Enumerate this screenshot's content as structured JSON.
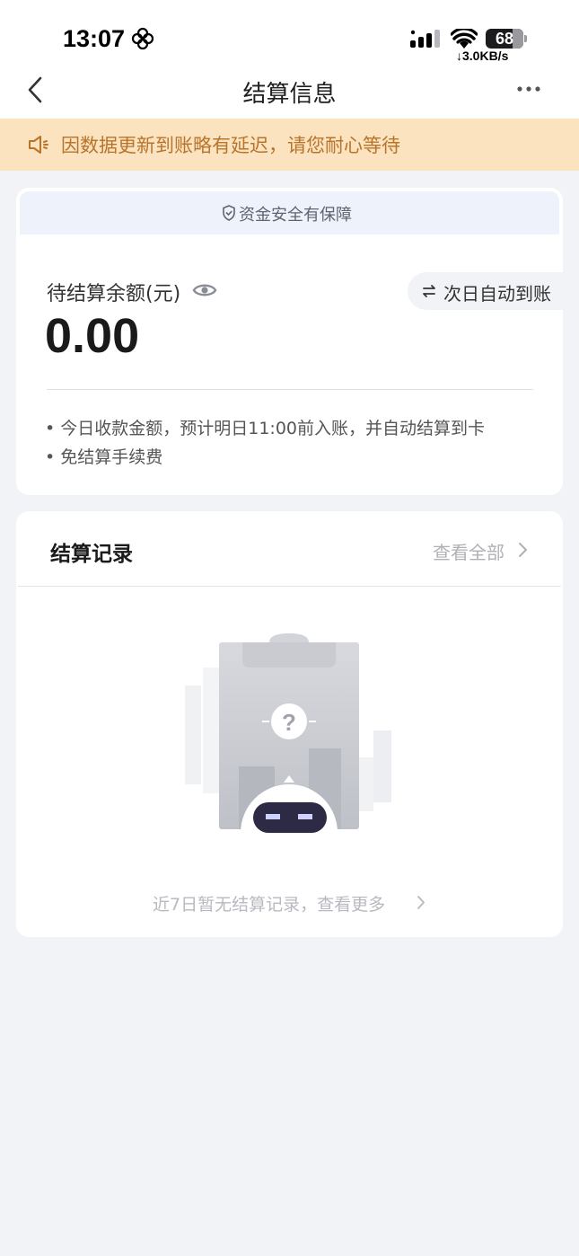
{
  "status_bar": {
    "time": "13:07",
    "battery": "68",
    "net_speed": "↓3.0KB/s"
  },
  "nav": {
    "title": "结算信息"
  },
  "notice": {
    "text": "因数据更新到账略有延迟，请您耐心等待",
    "color": "#b9742b",
    "background": "#fbe3c0"
  },
  "balance": {
    "safety_text": "资金安全有保障",
    "label": "待结算余额(元)",
    "amount": "0.00",
    "auto_label": "次日自动到账",
    "notes": [
      "• 今日收款金额，预计明日11:00前入账，并自动结算到卡",
      "• 免结算手续费"
    ]
  },
  "records": {
    "title": "结算记录",
    "view_all": "查看全部",
    "empty_text": "近7日暂无结算记录，查看更多"
  },
  "icons": [
    "flower-icon",
    "signal-icon",
    "wifi-icon",
    "battery-icon",
    "back-icon",
    "more-icon",
    "speaker-icon",
    "shield-icon",
    "eye-icon",
    "swap-icon",
    "chevron-right-icon",
    "empty-clipboard-illustration"
  ]
}
